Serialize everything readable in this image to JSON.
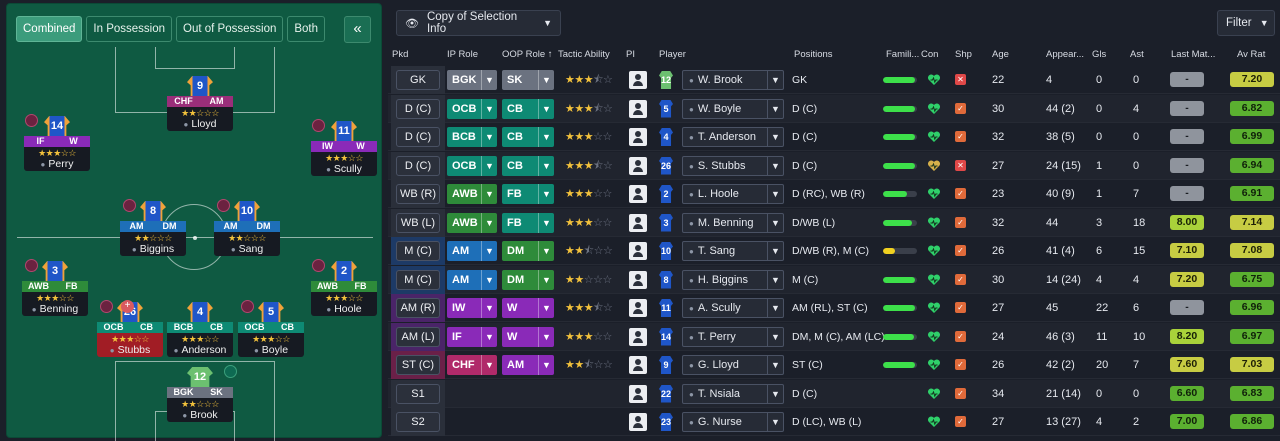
{
  "colors": {
    "accent": "#3c9c7c",
    "pitch": "#0f5a42",
    "gk": "#6b7280",
    "def": "#0e8a74",
    "def_green": "#2e8b3a",
    "mid": "#1e6fb8",
    "att": "#8a2ab8",
    "st": "#b02a6a"
  },
  "pitch_panel": {
    "tabs": [
      "Combined",
      "In Possession",
      "Out of Possession",
      "Both"
    ],
    "collapse_icon": "double-chevron-left-icon"
  },
  "pitch_players": [
    {
      "id": "lloyd",
      "num": "9",
      "roles": [
        "CHF",
        "AM"
      ],
      "stars": "★★☆☆☆",
      "name": "Lloyd",
      "role_color": "#9a2e7a"
    },
    {
      "id": "perry",
      "num": "14",
      "roles": [
        "IF",
        "W"
      ],
      "stars": "★★★☆☆",
      "name": "Perry",
      "role_color": "#8a2ab8"
    },
    {
      "id": "scully",
      "num": "11",
      "roles": [
        "IW",
        "W"
      ],
      "stars": "★★★☆☆",
      "name": "Scully",
      "role_color": "#8a2ab8"
    },
    {
      "id": "biggins",
      "num": "8",
      "roles": [
        "AM",
        "DM"
      ],
      "stars": "★★☆☆☆",
      "name": "Biggins",
      "role_color": "#1e6fb8"
    },
    {
      "id": "sang",
      "num": "10",
      "roles": [
        "AM",
        "DM"
      ],
      "stars": "★★☆☆☆",
      "name": "Sang",
      "role_color": "#1e6fb8"
    },
    {
      "id": "benning",
      "num": "3",
      "roles": [
        "AWB",
        "FB"
      ],
      "stars": "★★★☆☆",
      "name": "Benning",
      "role_color": "#2e8b3a"
    },
    {
      "id": "hoole",
      "num": "2",
      "roles": [
        "AWB",
        "FB"
      ],
      "stars": "★★★☆☆",
      "name": "Hoole",
      "role_color": "#2e8b3a"
    },
    {
      "id": "stubbs",
      "num": "26",
      "roles": [
        "OCB",
        "CB"
      ],
      "stars": "★★★☆☆",
      "name": "Stubbs",
      "role_color": "#0e8a74"
    },
    {
      "id": "anderson",
      "num": "4",
      "roles": [
        "BCB",
        "CB"
      ],
      "stars": "★★★☆☆",
      "name": "Anderson",
      "role_color": "#0e8a74"
    },
    {
      "id": "boyle",
      "num": "5",
      "roles": [
        "OCB",
        "CB"
      ],
      "stars": "★★★☆☆",
      "name": "Boyle",
      "role_color": "#0e8a74"
    },
    {
      "id": "brook",
      "num": "12",
      "roles": [
        "BGK",
        "SK"
      ],
      "stars": "★★☆☆☆",
      "name": "Brook",
      "role_color": "#6b7280"
    }
  ],
  "toolbar": {
    "copy_label": "Copy of Selection Info",
    "copy_icon": "eye-icon",
    "filter_label": "Filter"
  },
  "table": {
    "headers": {
      "pkd": "Pkd",
      "ip_role": "IP Role",
      "oop_role": "OOP Role",
      "tactic": "Tactic Ability",
      "pi": "PI",
      "player": "Player",
      "positions": "Positions",
      "fam": "Famili...",
      "con": "Con",
      "shp": "Shp",
      "age": "Age",
      "apps": "Appear...",
      "gls": "Gls",
      "ast": "Ast",
      "last": "Last Mat...",
      "avrat": "Av Rat"
    },
    "rows": [
      {
        "pkd": "GK",
        "ip": "BGK",
        "oop": "SK",
        "ip_c": "#6b7280",
        "oop_c": "#6b7280",
        "stars": "★★★",
        "half": true,
        "num": "12",
        "gk": true,
        "name": "W. Brook",
        "pos": "GK",
        "fam": 0.95,
        "con": "green",
        "age": "22",
        "apps": "4",
        "gls": "0",
        "ast": "0",
        "last": "-",
        "avrat": "7.20",
        "avrat_c": "olive"
      },
      {
        "pkd": "D (C)",
        "ip": "OCB",
        "oop": "CB",
        "ip_c": "#0e8a74",
        "oop_c": "#0e8a74",
        "stars": "★★★",
        "half": true,
        "num": "5",
        "gk": false,
        "name": "W. Boyle",
        "pos": "D (C)",
        "fam": 0.95,
        "con": "green",
        "age": "30",
        "apps": "44 (2)",
        "gls": "0",
        "ast": "4",
        "last": "-",
        "avrat": "6.82",
        "avrat_c": "green"
      },
      {
        "pkd": "D (C)",
        "ip": "BCB",
        "oop": "CB",
        "ip_c": "#0e8a74",
        "oop_c": "#0e8a74",
        "stars": "★★★",
        "half": false,
        "num": "4",
        "gk": false,
        "name": "T. Anderson",
        "pos": "D (C)",
        "fam": 0.95,
        "con": "green",
        "age": "32",
        "apps": "38 (5)",
        "gls": "0",
        "ast": "0",
        "last": "-",
        "avrat": "6.99",
        "avrat_c": "green"
      },
      {
        "pkd": "D (C)",
        "ip": "OCB",
        "oop": "CB",
        "ip_c": "#0e8a74",
        "oop_c": "#0e8a74",
        "stars": "★★★",
        "half": true,
        "num": "26",
        "gk": false,
        "name": "S. Stubbs",
        "pos": "D (C)",
        "fam": 0.95,
        "con": "amber",
        "age": "27",
        "apps": "24 (15)",
        "gls": "1",
        "ast": "0",
        "last": "-",
        "avrat": "6.94",
        "avrat_c": "green"
      },
      {
        "pkd": "WB (R)",
        "ip": "AWB",
        "oop": "FB",
        "ip_c": "#2e8b3a",
        "oop_c": "#0e8a74",
        "stars": "★★★",
        "half": false,
        "num": "2",
        "gk": false,
        "name": "L. Hoole",
        "pos": "D (RC), WB (R)",
        "fam": 0.7,
        "con": "green",
        "age": "23",
        "apps": "40 (9)",
        "gls": "1",
        "ast": "7",
        "last": "-",
        "avrat": "6.91",
        "avrat_c": "green"
      },
      {
        "pkd": "WB (L)",
        "ip": "AWB",
        "oop": "FB",
        "ip_c": "#2e8b3a",
        "oop_c": "#0e8a74",
        "stars": "★★★",
        "half": false,
        "num": "3",
        "gk": false,
        "name": "M. Benning",
        "pos": "D/WB (L)",
        "fam": 0.85,
        "con": "green",
        "age": "32",
        "apps": "44",
        "gls": "3",
        "ast": "18",
        "last": "8.00",
        "last_c": "lime",
        "avrat": "7.14",
        "avrat_c": "olive"
      },
      {
        "pkd": "M (C)",
        "ip": "AM",
        "oop": "DM",
        "ip_c": "#1e6fb8",
        "oop_c": "#2e8b3a",
        "stars": "★★",
        "half": true,
        "num": "10",
        "gk": false,
        "name": "T. Sang",
        "pos": "D/WB (R), M (C)",
        "fam": 0.35,
        "fam_c": "#f0d020",
        "con": "green",
        "age": "26",
        "apps": "41 (4)",
        "gls": "6",
        "ast": "15",
        "last": "7.10",
        "last_c": "olive",
        "avrat": "7.08",
        "avrat_c": "olive"
      },
      {
        "pkd": "M (C)",
        "ip": "AM",
        "oop": "DM",
        "ip_c": "#1e6fb8",
        "oop_c": "#2e8b3a",
        "stars": "★★",
        "half": false,
        "num": "8",
        "gk": false,
        "name": "H. Biggins",
        "pos": "M (C)",
        "fam": 0.95,
        "con": "green",
        "age": "30",
        "apps": "14 (24)",
        "gls": "4",
        "ast": "4",
        "last": "7.20",
        "last_c": "olive",
        "avrat": "6.75",
        "avrat_c": "green"
      },
      {
        "pkd": "AM (R)",
        "ip": "IW",
        "oop": "W",
        "ip_c": "#8a2ab8",
        "oop_c": "#8a2ab8",
        "stars": "★★★",
        "half": true,
        "num": "11",
        "gk": false,
        "name": "A. Scully",
        "pos": "AM (RL), ST (C)",
        "fam": 0.95,
        "con": "green",
        "age": "27",
        "apps": "45",
        "gls": "22",
        "ast": "6",
        "last": "-",
        "avrat": "6.96",
        "avrat_c": "green"
      },
      {
        "pkd": "AM (L)",
        "ip": "IF",
        "oop": "W",
        "ip_c": "#8a2ab8",
        "oop_c": "#8a2ab8",
        "stars": "★★★",
        "half": false,
        "num": "14",
        "gk": false,
        "name": "T. Perry",
        "pos": "DM, M (C), AM (LC)",
        "fam": 0.9,
        "con": "green",
        "age": "24",
        "apps": "46 (3)",
        "gls": "11",
        "ast": "10",
        "last": "8.20",
        "last_c": "lime",
        "avrat": "6.97",
        "avrat_c": "green"
      },
      {
        "pkd": "ST (C)",
        "ip": "CHF",
        "oop": "AM",
        "ip_c": "#b02a6a",
        "oop_c": "#8a2ab8",
        "stars": "★★",
        "half": true,
        "num": "9",
        "gk": false,
        "name": "G. Lloyd",
        "pos": "ST (C)",
        "fam": 0.95,
        "con": "green",
        "age": "26",
        "apps": "42 (2)",
        "gls": "20",
        "ast": "7",
        "last": "7.60",
        "last_c": "olive",
        "avrat": "7.03",
        "avrat_c": "olive"
      },
      {
        "pkd": "S1",
        "ip": "",
        "oop": "",
        "stars": "",
        "half": false,
        "num": "22",
        "gk": false,
        "name": "T. Nsiala",
        "pos": "D (C)",
        "fam": 0,
        "con": "green",
        "age": "34",
        "apps": "21 (14)",
        "gls": "0",
        "ast": "0",
        "last": "6.60",
        "last_c": "green",
        "avrat": "6.83",
        "avrat_c": "green"
      },
      {
        "pkd": "S2",
        "ip": "",
        "oop": "",
        "stars": "",
        "half": false,
        "num": "23",
        "gk": false,
        "name": "G. Nurse",
        "pos": "D (LC), WB (L)",
        "fam": 0,
        "con": "green",
        "age": "27",
        "apps": "13 (27)",
        "gls": "4",
        "ast": "2",
        "last": "7.00",
        "last_c": "green",
        "avrat": "6.86",
        "avrat_c": "green"
      }
    ]
  }
}
